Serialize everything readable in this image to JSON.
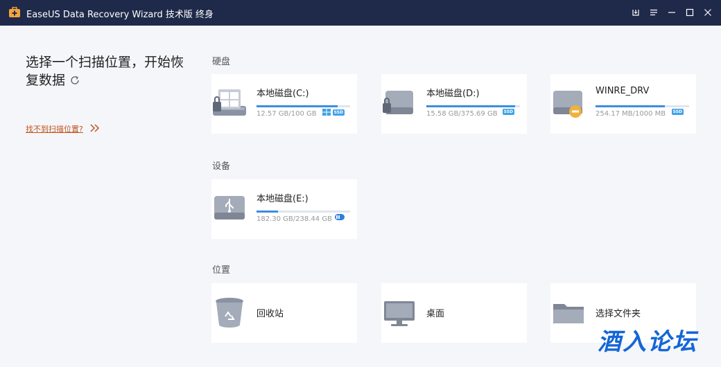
{
  "window": {
    "title": "EaseUS Data Recovery Wizard 技术版 终身",
    "controls": [
      "feedback",
      "menu",
      "minimize",
      "maximize",
      "close"
    ]
  },
  "left": {
    "heading": "选择一个扫描位置，开始恢复数据",
    "help_link": "找不到扫描位置?"
  },
  "sections": {
    "disks": "硬盘",
    "devices": "设备",
    "locations": "位置"
  },
  "disks": [
    {
      "name": "本地磁盘(C:)",
      "size": "12.57 GB/100 GB",
      "usage": 0.87,
      "badges": [
        "windows",
        "ssd"
      ],
      "icon": "windows-drive-icon"
    },
    {
      "name": "本地磁盘(D:)",
      "size": "15.58 GB/375.69 GB",
      "usage": 0.95,
      "badges": [
        "ssd"
      ],
      "icon": "hard-drive-icon"
    },
    {
      "name": "WINRE_DRV",
      "size": "254.17 MB/1000 MB",
      "usage": 0.74,
      "badges": [
        "ssd"
      ],
      "icon": "hidden-drive-icon"
    }
  ],
  "devices": [
    {
      "name": "本地磁盘(E:)",
      "size": "182.30 GB/238.44 GB",
      "usage": 0.23,
      "badges": [
        "usb"
      ],
      "icon": "usb-drive-icon"
    }
  ],
  "locations": [
    {
      "name": "回收站",
      "icon": "recycle-bin-icon"
    },
    {
      "name": "桌面",
      "icon": "desktop-icon"
    },
    {
      "name": "选择文件夹",
      "icon": "folder-icon"
    }
  ],
  "watermark": "酒入论坛",
  "colors": {
    "titlebar": "#1f2a4a",
    "accent": "#3b8de0",
    "link": "#c0541b",
    "watermark": "#1466d6"
  }
}
